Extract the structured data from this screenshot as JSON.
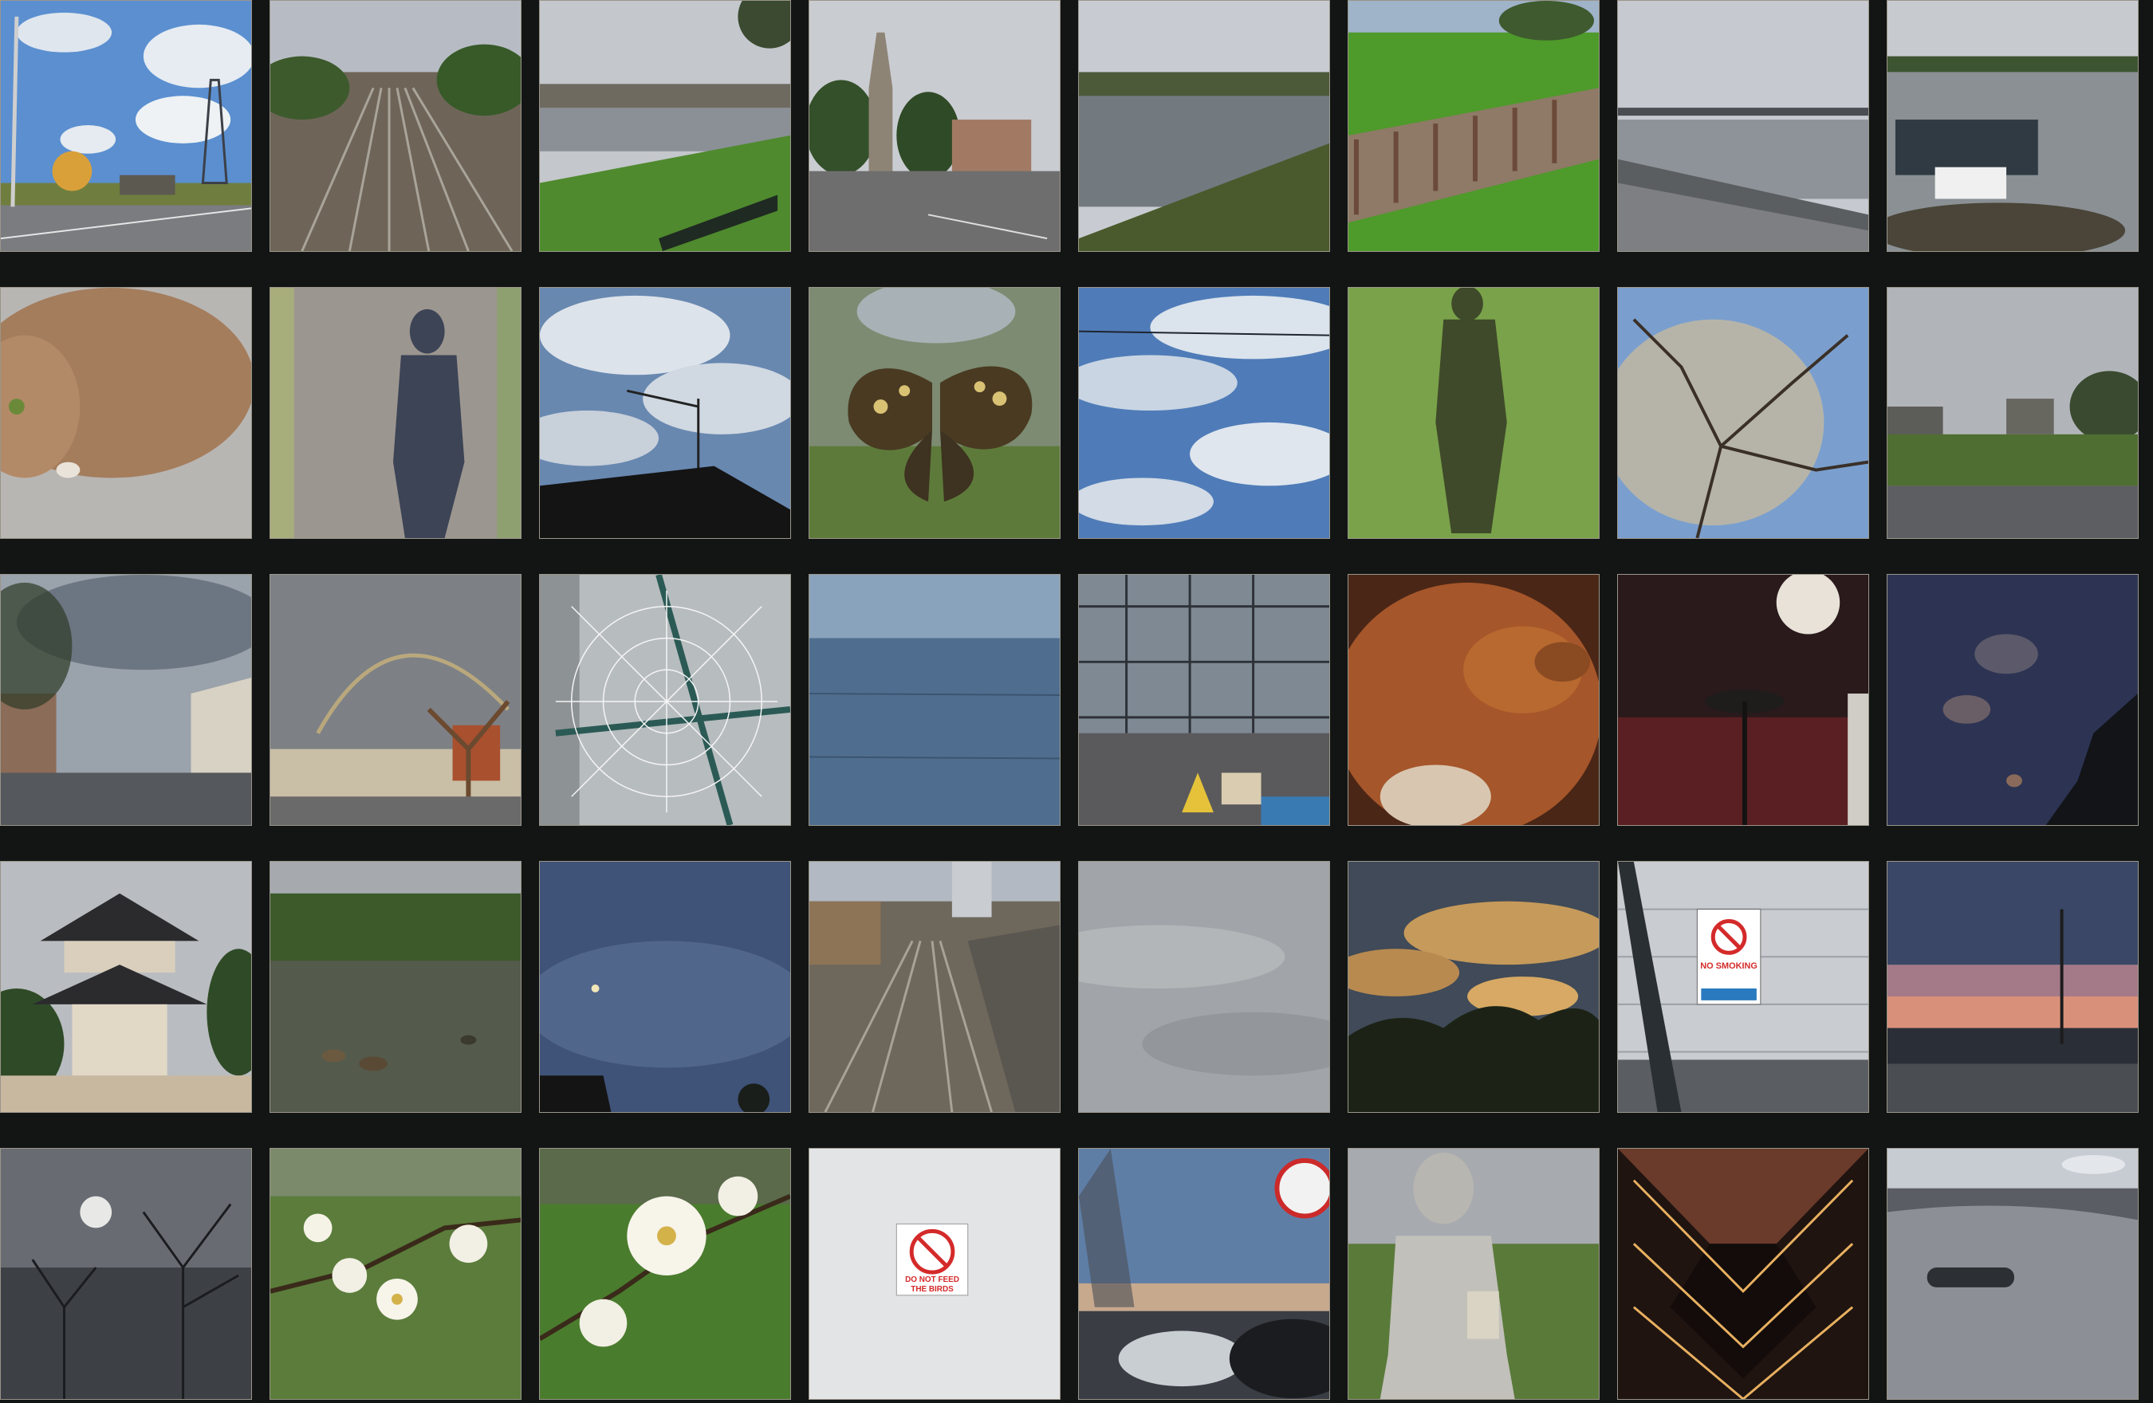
{
  "gallery": {
    "tiles": [
      {
        "name": "photo-road-pylon",
        "alt": ""
      },
      {
        "name": "photo-railway-tracks",
        "alt": ""
      },
      {
        "name": "photo-river-bench",
        "alt": ""
      },
      {
        "name": "photo-clock-tower",
        "alt": ""
      },
      {
        "name": "photo-river-bank",
        "alt": ""
      },
      {
        "name": "photo-old-rail-grass",
        "alt": ""
      },
      {
        "name": "photo-river-bridge",
        "alt": ""
      },
      {
        "name": "photo-river-boats",
        "alt": ""
      },
      {
        "name": "photo-cat",
        "alt": ""
      },
      {
        "name": "photo-shadow-path",
        "alt": ""
      },
      {
        "name": "photo-birds-antenna",
        "alt": ""
      },
      {
        "name": "photo-butterfly",
        "alt": ""
      },
      {
        "name": "photo-sky-wire",
        "alt": ""
      },
      {
        "name": "photo-shadow-grass",
        "alt": ""
      },
      {
        "name": "photo-blossom-tree",
        "alt": ""
      },
      {
        "name": "photo-misty-green",
        "alt": ""
      },
      {
        "name": "photo-street-corner",
        "alt": ""
      },
      {
        "name": "photo-rainbow-street",
        "alt": ""
      },
      {
        "name": "photo-spider-web",
        "alt": ""
      },
      {
        "name": "photo-blue-surface",
        "alt": ""
      },
      {
        "name": "photo-building-reflection",
        "alt": ""
      },
      {
        "name": "photo-dog",
        "alt": ""
      },
      {
        "name": "photo-dark-interior",
        "alt": ""
      },
      {
        "name": "photo-night-sky",
        "alt": ""
      },
      {
        "name": "photo-pagoda",
        "alt": ""
      },
      {
        "name": "photo-pond-ducks",
        "alt": ""
      },
      {
        "name": "photo-dusk-sky",
        "alt": ""
      },
      {
        "name": "photo-rail-cutting",
        "alt": ""
      },
      {
        "name": "photo-grey-clouds",
        "alt": ""
      },
      {
        "name": "photo-sunset-clouds",
        "alt": ""
      },
      {
        "name": "photo-no-smoking-window",
        "alt": ""
      },
      {
        "name": "photo-pink-dusk-mast",
        "alt": ""
      },
      {
        "name": "photo-misty-trees",
        "alt": ""
      },
      {
        "name": "photo-blossom-branch",
        "alt": ""
      },
      {
        "name": "photo-white-blossom",
        "alt": ""
      },
      {
        "name": "photo-bird-sign",
        "alt": ""
      },
      {
        "name": "photo-car-park-sunset",
        "alt": ""
      },
      {
        "name": "photo-buddha-statue",
        "alt": ""
      },
      {
        "name": "photo-lit-corridor",
        "alt": ""
      },
      {
        "name": "photo-car-door",
        "alt": ""
      }
    ]
  },
  "signs": {
    "no_smoking": "NO SMOKING",
    "do_not_feed_1": "DO NOT FEED",
    "do_not_feed_2": "THE BIRDS"
  }
}
